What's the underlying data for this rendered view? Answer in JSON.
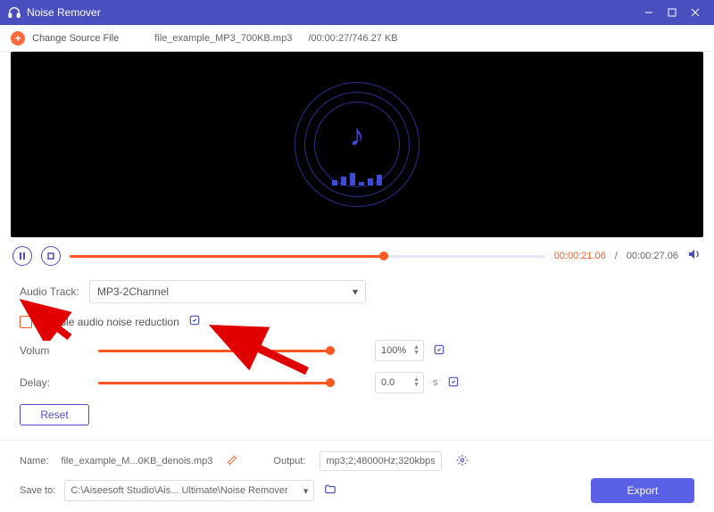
{
  "window": {
    "title": "Noise Remover"
  },
  "topbar": {
    "change_label": "Change Source File",
    "filename": "file_example_MP3_700KB.mp3",
    "meta": "/00:00:27/746.27 KB"
  },
  "playback": {
    "current_time": "00:00:21.06",
    "total_time": "00:00:27.06",
    "progress_pct": 66
  },
  "track": {
    "label": "Audio Track:",
    "selected": "MP3-2Channel"
  },
  "noise": {
    "checkbox_label": "Enable audio noise reduction"
  },
  "volume": {
    "label": "Volum",
    "value": "100%"
  },
  "delay": {
    "label": "Delay:",
    "value": "0.0",
    "unit": "s"
  },
  "reset_label": "Reset",
  "output": {
    "name_label": "Name:",
    "name_value": "file_example_M...0KB_denois.mp3",
    "output_label": "Output:",
    "output_value": "mp3;2;48000Hz;320kbps",
    "saveto_label": "Save to:",
    "saveto_value": "C:\\Aiseesoft Studio\\Ais... Ultimate\\Noise Remover"
  },
  "export_label": "Export"
}
